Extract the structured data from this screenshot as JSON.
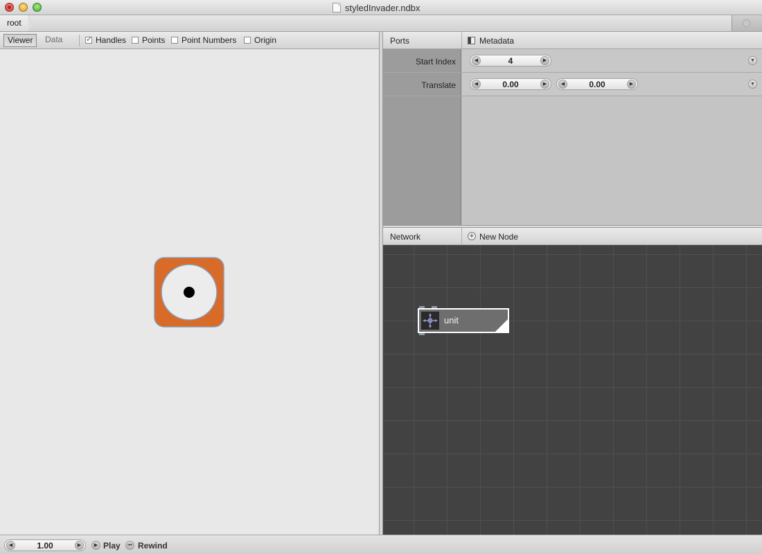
{
  "window": {
    "title": "styledInvader.ndbx"
  },
  "breadcrumb": {
    "root_label": "root"
  },
  "viewer": {
    "tabs": [
      {
        "label": "Viewer",
        "active": true
      },
      {
        "label": "Data",
        "active": false
      }
    ],
    "options": [
      {
        "label": "Handles",
        "checked": true
      },
      {
        "label": "Points",
        "checked": false
      },
      {
        "label": "Point Numbers",
        "checked": false
      },
      {
        "label": "Origin",
        "checked": false
      }
    ],
    "shape_colors": {
      "fill": "#d96b28",
      "stroke": "#8a9ab8",
      "inner": "#ececec",
      "dot": "#000000"
    }
  },
  "ports": {
    "header_label": "Ports",
    "metadata_label": "Metadata",
    "rows": [
      {
        "label": "Start Index",
        "values": [
          "4"
        ]
      },
      {
        "label": "Translate",
        "values": [
          "0.00",
          "0.00"
        ]
      }
    ]
  },
  "network": {
    "header_label": "Network",
    "new_node_label": "New Node",
    "nodes": [
      {
        "label": "unit",
        "icon": "translate-icon"
      }
    ]
  },
  "bottom": {
    "frame_value": "1.00",
    "play_label": "Play",
    "rewind_label": "Rewind"
  }
}
